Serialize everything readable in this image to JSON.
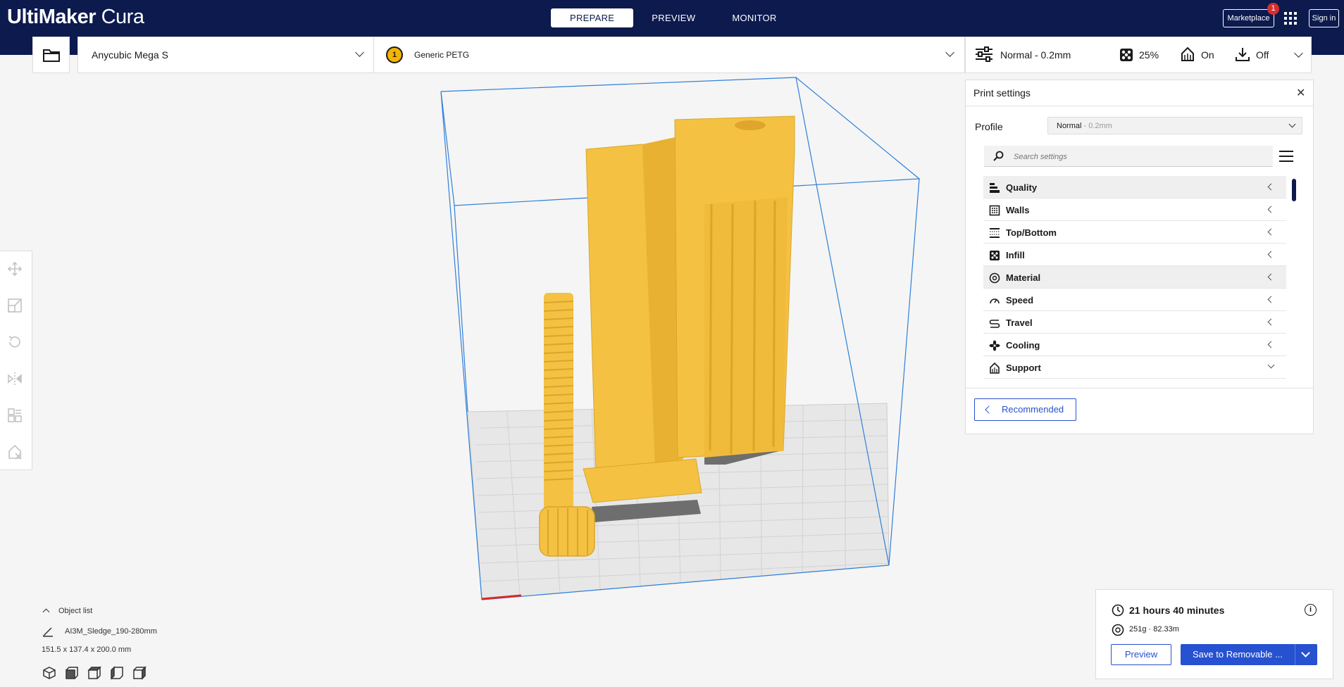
{
  "app": {
    "logo_bold": "UltiMaker",
    "logo_light": " Cura"
  },
  "stage_tabs": [
    {
      "label": "PREPARE",
      "active": true
    },
    {
      "label": "PREVIEW",
      "active": false
    },
    {
      "label": "MONITOR",
      "active": false
    }
  ],
  "header": {
    "marketplace_label": "Marketplace",
    "marketplace_badge": "1",
    "signin_label": "Sign in"
  },
  "machine": {
    "name": "Anycubic Mega S"
  },
  "material": {
    "extruder_number": "1",
    "name": "Generic PETG",
    "color": "#f5b400"
  },
  "print_setup": {
    "profile": "Normal - 0.2mm",
    "infill": "25%",
    "support": "On",
    "adhesion": "Off"
  },
  "print_settings": {
    "title": "Print settings",
    "close_glyph": "✕",
    "profile_label": "Profile",
    "profile_value": "Normal",
    "profile_value_suffix": " - 0.2mm",
    "search_placeholder": "Search settings",
    "categories": [
      {
        "label": "Quality",
        "icon": "quality-icon",
        "expanded": false,
        "shaded": true
      },
      {
        "label": "Walls",
        "icon": "walls-icon",
        "expanded": false,
        "shaded": false
      },
      {
        "label": "Top/Bottom",
        "icon": "top-bottom-icon",
        "expanded": false,
        "shaded": false
      },
      {
        "label": "Infill",
        "icon": "infill-icon",
        "expanded": false,
        "shaded": false
      },
      {
        "label": "Material",
        "icon": "material-icon",
        "expanded": false,
        "shaded": true
      },
      {
        "label": "Speed",
        "icon": "speed-icon",
        "expanded": false,
        "shaded": false
      },
      {
        "label": "Travel",
        "icon": "travel-icon",
        "expanded": false,
        "shaded": false
      },
      {
        "label": "Cooling",
        "icon": "cooling-icon",
        "expanded": false,
        "shaded": false
      },
      {
        "label": "Support",
        "icon": "support-icon",
        "expanded": true,
        "shaded": false
      }
    ],
    "recommended_label": "Recommended"
  },
  "object_list": {
    "header": "Object list",
    "object_name": "AI3M_Sledge_190-280mm",
    "dimensions": "151.5 x 137.4 x 200.0 mm"
  },
  "job": {
    "print_time": "21 hours 40 minutes",
    "material_usage": "251g · 82.33m",
    "info_glyph": "i",
    "preview_label": "Preview",
    "save_label": "Save to Removable ..."
  },
  "colors": {
    "header_bg": "#0c1a4e",
    "accent": "#2651d0",
    "model": "#f5c142",
    "build_volume": "#2f7fd8"
  }
}
